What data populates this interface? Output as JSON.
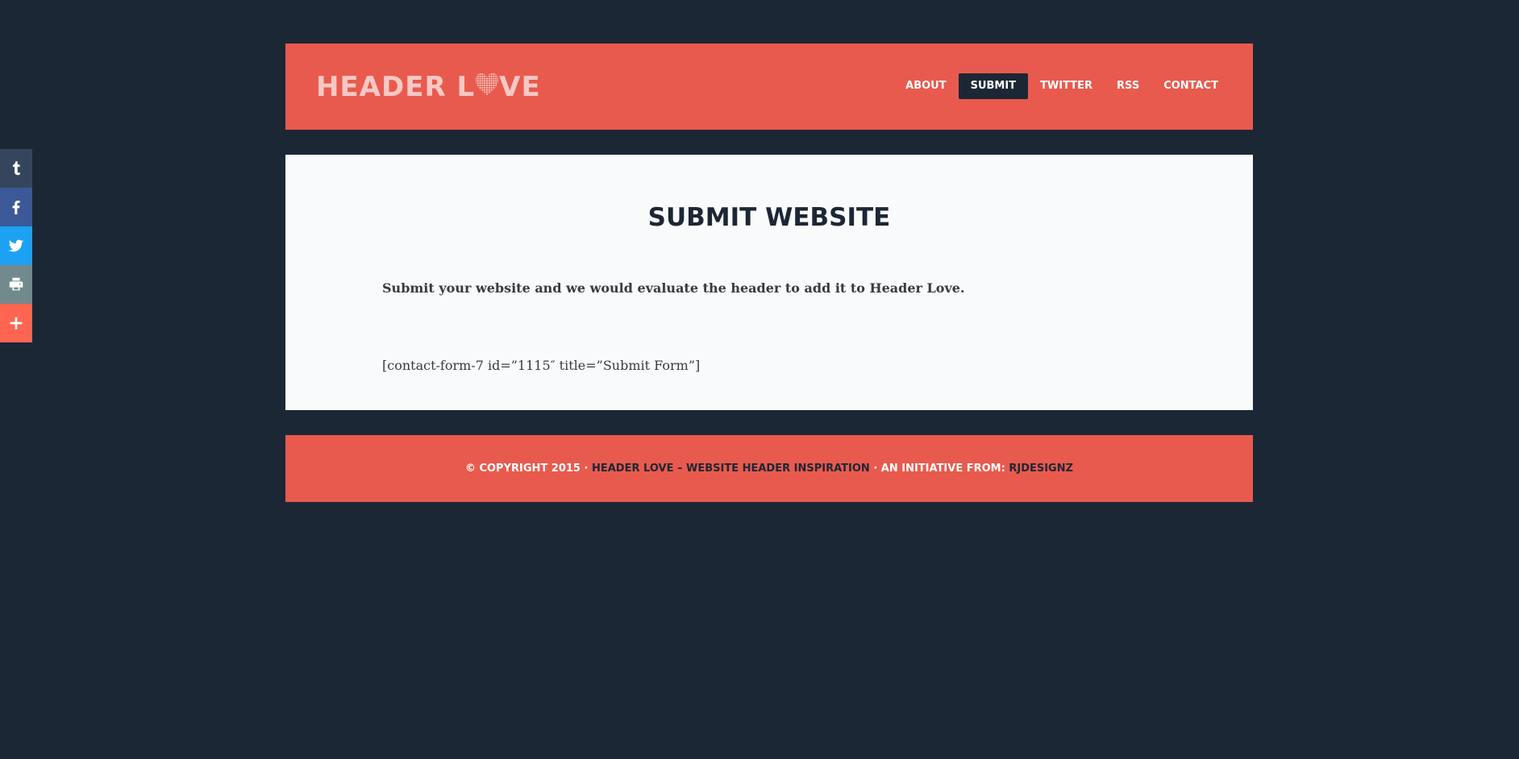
{
  "header": {
    "logo_text_before": "HEADER L",
    "logo_text_after": "VE",
    "nav": [
      {
        "label": "ABOUT",
        "active": false
      },
      {
        "label": "SUBMIT",
        "active": true
      },
      {
        "label": "TWITTER",
        "active": false
      },
      {
        "label": "RSS",
        "active": false
      },
      {
        "label": "CONTACT",
        "active": false
      }
    ]
  },
  "main": {
    "title": "SUBMIT WEBSITE",
    "lead": "Submit your website and we would evaluate the header to add it to Header Love.",
    "shortcode": "[contact-form-7 id=”1115″ title=”Submit Form”]"
  },
  "footer": {
    "copyright": "© COPYRIGHT 2015 · ",
    "site_link": "HEADER LOVE – WEBSITE HEADER INSPIRATION",
    "initiative": " · AN INITIATIVE FROM: ",
    "author_link": "RJDESIGNZ"
  },
  "share": [
    {
      "icon": "tumblr-icon",
      "color": "#35465c"
    },
    {
      "icon": "facebook-icon",
      "color": "#3b5998"
    },
    {
      "icon": "twitter-icon",
      "color": "#1da1f2"
    },
    {
      "icon": "print-icon",
      "color": "#738a8d"
    },
    {
      "icon": "plus-icon",
      "color": "#ff6550"
    }
  ],
  "colors": {
    "background": "#1c2735",
    "accent": "#e95a4e",
    "content_bg": "#f9fafb"
  }
}
